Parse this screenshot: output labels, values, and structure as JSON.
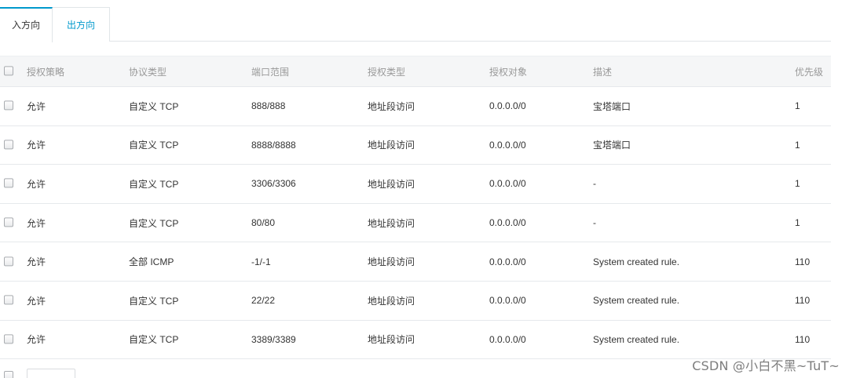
{
  "tabs": [
    {
      "label": "入方向",
      "active": true
    },
    {
      "label": "出方向",
      "active": false
    }
  ],
  "table": {
    "headers": {
      "policy": "授权策略",
      "protocol": "协议类型",
      "port": "端口范围",
      "auth_type": "授权类型",
      "object": "授权对象",
      "description": "描述",
      "priority": "优先级"
    },
    "rows": [
      {
        "policy": "允许",
        "protocol": "自定义 TCP",
        "port": "888/888",
        "auth_type": "地址段访问",
        "object": "0.0.0.0/0",
        "description": "宝塔端口",
        "priority": "1"
      },
      {
        "policy": "允许",
        "protocol": "自定义 TCP",
        "port": "8888/8888",
        "auth_type": "地址段访问",
        "object": "0.0.0.0/0",
        "description": "宝塔端口",
        "priority": "1"
      },
      {
        "policy": "允许",
        "protocol": "自定义 TCP",
        "port": "3306/3306",
        "auth_type": "地址段访问",
        "object": "0.0.0.0/0",
        "description": "-",
        "priority": "1"
      },
      {
        "policy": "允许",
        "protocol": "自定义 TCP",
        "port": "80/80",
        "auth_type": "地址段访问",
        "object": "0.0.0.0/0",
        "description": "-",
        "priority": "1"
      },
      {
        "policy": "允许",
        "protocol": "全部 ICMP",
        "port": "-1/-1",
        "auth_type": "地址段访问",
        "object": "0.0.0.0/0",
        "description": "System created rule.",
        "priority": "110"
      },
      {
        "policy": "允许",
        "protocol": "自定义 TCP",
        "port": "22/22",
        "auth_type": "地址段访问",
        "object": "0.0.0.0/0",
        "description": "System created rule.",
        "priority": "110"
      },
      {
        "policy": "允许",
        "protocol": "自定义 TCP",
        "port": "3389/3389",
        "auth_type": "地址段访问",
        "object": "0.0.0.0/0",
        "description": "System created rule.",
        "priority": "110"
      }
    ]
  },
  "watermark": "CSDN @小白不黑~TuT~",
  "colors": {
    "accent": "#0099cc",
    "header_bg": "#f5f6f7",
    "border": "#e6e9ec"
  }
}
